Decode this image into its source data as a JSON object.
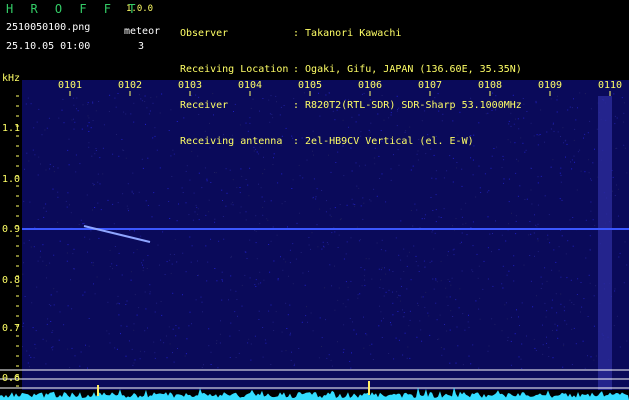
{
  "app": {
    "title": "H R O F F T",
    "version": "1.0.0"
  },
  "file": {
    "name": "2510050100.png",
    "datetime": "25.10.05 01:00"
  },
  "meteor": {
    "label": "meteor",
    "count": "3"
  },
  "info": [
    {
      "label": "Observer",
      "value": ": Takanori Kawachi"
    },
    {
      "label": "Receiving Location",
      "value": ": Ogaki, Gifu, JAPAN (136.60E, 35.35N)"
    },
    {
      "label": "Receiver",
      "value": ": R820T2(RTL-SDR) SDR-Sharp 53.1000MHz"
    },
    {
      "label": "Receiving antenna",
      "value": ": 2el-HB9CV Vertical (el. E-W)"
    }
  ],
  "xaxis": {
    "ticks": [
      "0101",
      "0102",
      "0103",
      "0104",
      "0105",
      "0106",
      "0107",
      "0108",
      "0109",
      "0110"
    ]
  },
  "yaxis": {
    "unit": "kHz",
    "ticks": [
      "1.1",
      "1.0",
      "0.9",
      "0.8",
      "0.7",
      "0.6"
    ]
  },
  "colors": {
    "background": "#000000",
    "plot": "#10106a",
    "trace": "#4060ff",
    "text_yellow": "#ffff66",
    "title_green": "#33cc66",
    "signal": "#33ddff"
  }
}
